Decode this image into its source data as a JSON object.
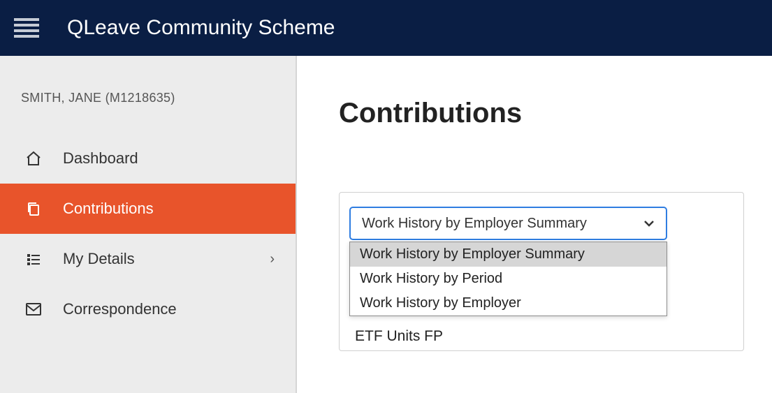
{
  "header": {
    "title": "QLeave Community Scheme"
  },
  "sidebar": {
    "user_label": "SMITH, JANE (M1218635)",
    "items": [
      {
        "label": "Dashboard"
      },
      {
        "label": "Contributions"
      },
      {
        "label": "My Details"
      },
      {
        "label": "Correspondence"
      }
    ]
  },
  "main": {
    "title": "Contributions",
    "dropdown": {
      "selected": "Work History by Employer Summary",
      "options": [
        "Work History by Employer Summary",
        "Work History by Period",
        "Work History by Employer"
      ]
    },
    "etf_label": "ETF Units FP"
  }
}
